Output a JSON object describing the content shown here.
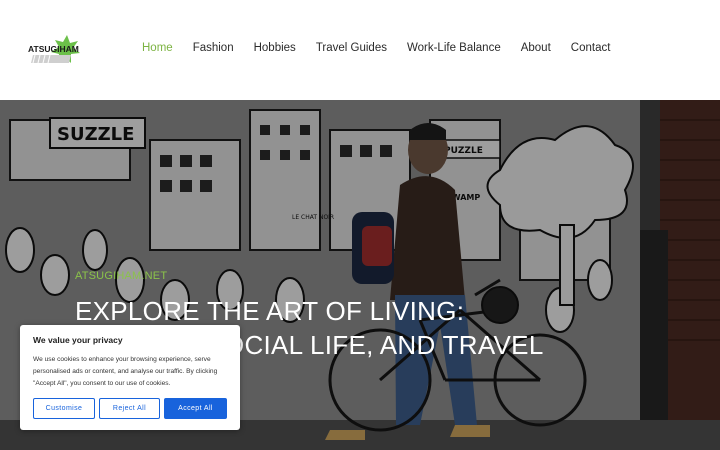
{
  "logo": {
    "text": "ATSUGIHAM"
  },
  "nav": {
    "items": [
      {
        "label": "Home",
        "active": true
      },
      {
        "label": "Fashion",
        "active": false
      },
      {
        "label": "Hobbies",
        "active": false
      },
      {
        "label": "Travel Guides",
        "active": false
      },
      {
        "label": "Work-Life Balance",
        "active": false
      },
      {
        "label": "About",
        "active": false
      },
      {
        "label": "Contact",
        "active": false
      }
    ]
  },
  "hero": {
    "kicker": "ATSUGIHAM.NET",
    "headline": "EXPLORE THE ART OF LIVING: FASHION, SOCIAL LIFE, AND TRAVEL AWAIT",
    "mural_text": {
      "sign1": "SUZZLE",
      "sign2": "PUZZLE",
      "sign3": "SWAMP",
      "sign4": "LE CHAT NOIR"
    }
  },
  "cookie": {
    "title": "We value your privacy",
    "text": "We use cookies to enhance your browsing experience, serve personalised ads or content, and analyse our traffic. By clicking \"Accept All\", you consent to our use of cookies.",
    "customise_label": "Customise",
    "reject_label": "Reject All",
    "accept_label": "Accept All"
  },
  "colors": {
    "accent_green": "#7cb342",
    "button_blue": "#1863dc"
  }
}
